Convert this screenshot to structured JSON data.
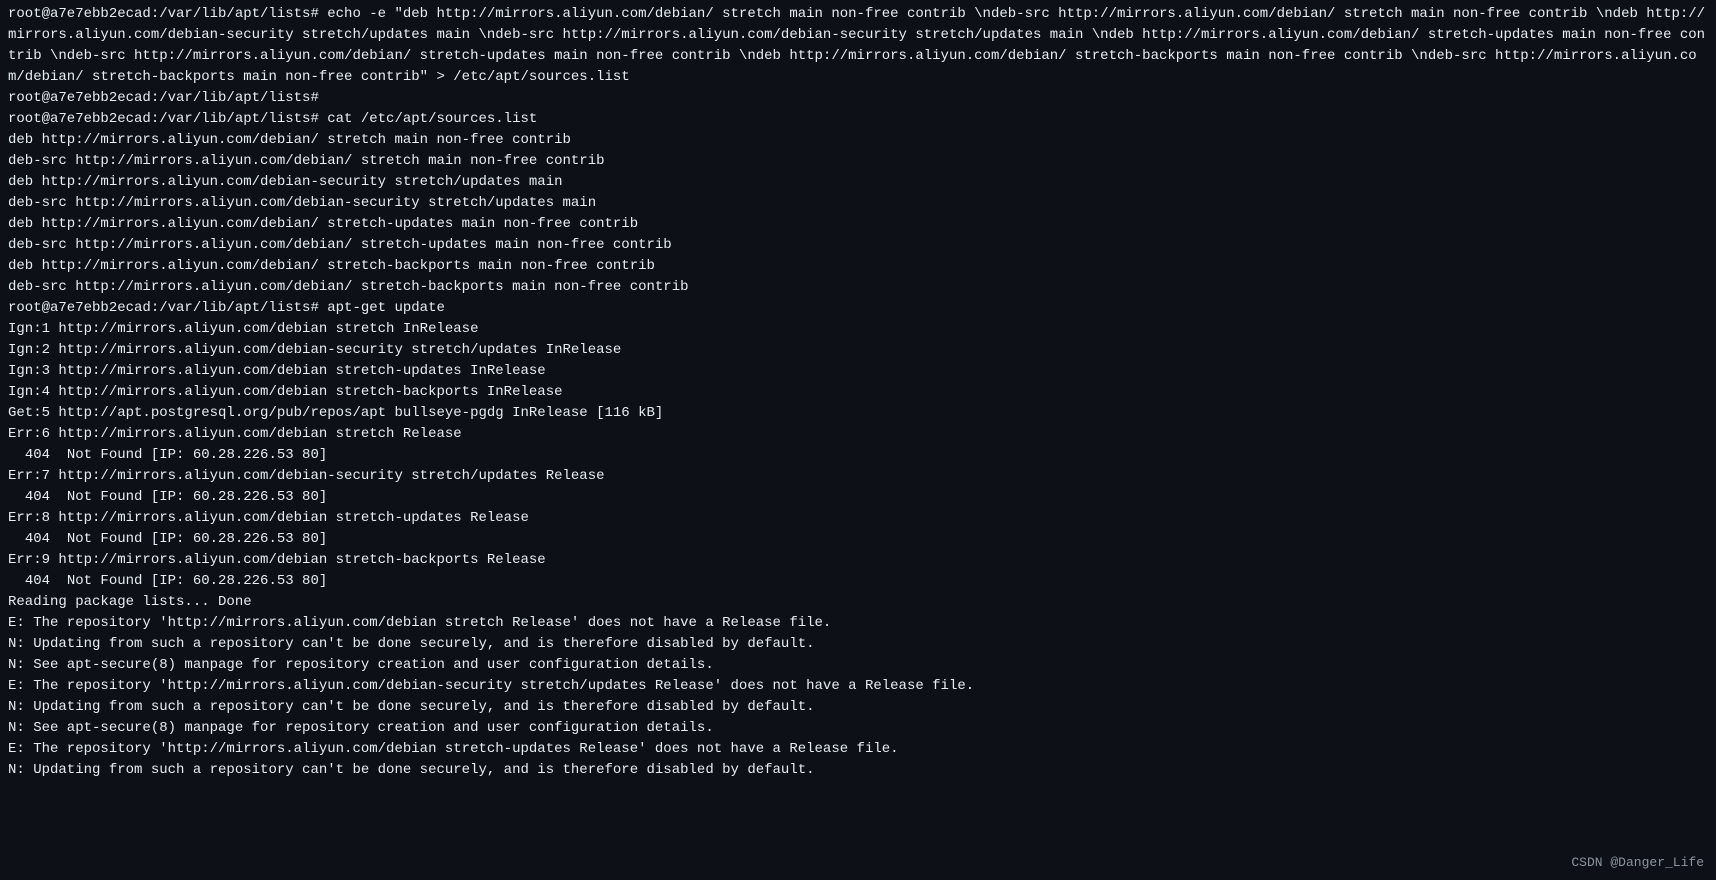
{
  "terminal": {
    "prompt": "root@a7e7ebb2ecad:/var/lib/apt/lists#",
    "lines": [
      "root@a7e7ebb2ecad:/var/lib/apt/lists# echo -e \"deb http://mirrors.aliyun.com/debian/ stretch main non-free contrib \\ndeb-src http://mirrors.aliyun.com/debian/ stretch main non-free contrib \\ndeb http://mirrors.aliyun.com/debian-security stretch/updates main \\ndeb-src http://mirrors.aliyun.com/debian-security stretch/updates main \\ndeb http://mirrors.aliyun.com/debian/ stretch-updates main non-free contrib \\ndeb-src http://mirrors.aliyun.com/debian/ stretch-updates main non-free contrib \\ndeb http://mirrors.aliyun.com/debian/ stretch-backports main non-free contrib \\ndeb-src http://mirrors.aliyun.com/debian/ stretch-backports main non-free contrib\" > /etc/apt/sources.list",
      "root@a7e7ebb2ecad:/var/lib/apt/lists#",
      "root@a7e7ebb2ecad:/var/lib/apt/lists# cat /etc/apt/sources.list",
      "deb http://mirrors.aliyun.com/debian/ stretch main non-free contrib ",
      "deb-src http://mirrors.aliyun.com/debian/ stretch main non-free contrib ",
      "deb http://mirrors.aliyun.com/debian-security stretch/updates main ",
      "deb-src http://mirrors.aliyun.com/debian-security stretch/updates main ",
      "deb http://mirrors.aliyun.com/debian/ stretch-updates main non-free contrib ",
      "deb-src http://mirrors.aliyun.com/debian/ stretch-updates main non-free contrib ",
      "deb http://mirrors.aliyun.com/debian/ stretch-backports main non-free contrib ",
      "deb-src http://mirrors.aliyun.com/debian/ stretch-backports main non-free contrib",
      "root@a7e7ebb2ecad:/var/lib/apt/lists# apt-get update",
      "Ign:1 http://mirrors.aliyun.com/debian stretch InRelease",
      "Ign:2 http://mirrors.aliyun.com/debian-security stretch/updates InRelease",
      "Ign:3 http://mirrors.aliyun.com/debian stretch-updates InRelease",
      "Ign:4 http://mirrors.aliyun.com/debian stretch-backports InRelease",
      "Get:5 http://apt.postgresql.org/pub/repos/apt bullseye-pgdg InRelease [116 kB]",
      "Err:6 http://mirrors.aliyun.com/debian stretch Release",
      "  404  Not Found [IP: 60.28.226.53 80]",
      "Err:7 http://mirrors.aliyun.com/debian-security stretch/updates Release",
      "  404  Not Found [IP: 60.28.226.53 80]",
      "Err:8 http://mirrors.aliyun.com/debian stretch-updates Release",
      "  404  Not Found [IP: 60.28.226.53 80]",
      "Err:9 http://mirrors.aliyun.com/debian stretch-backports Release",
      "  404  Not Found [IP: 60.28.226.53 80]",
      "Reading package lists... Done",
      "E: The repository 'http://mirrors.aliyun.com/debian stretch Release' does not have a Release file.",
      "N: Updating from such a repository can't be done securely, and is therefore disabled by default.",
      "N: See apt-secure(8) manpage for repository creation and user configuration details.",
      "E: The repository 'http://mirrors.aliyun.com/debian-security stretch/updates Release' does not have a Release file.",
      "N: Updating from such a repository can't be done securely, and is therefore disabled by default.",
      "N: See apt-secure(8) manpage for repository creation and user configuration details.",
      "E: The repository 'http://mirrors.aliyun.com/debian stretch-updates Release' does not have a Release file.",
      "N: Updating from such a repository can't be done securely, and is therefore disabled by default."
    ]
  },
  "watermark": "CSDN @Danger_Life"
}
